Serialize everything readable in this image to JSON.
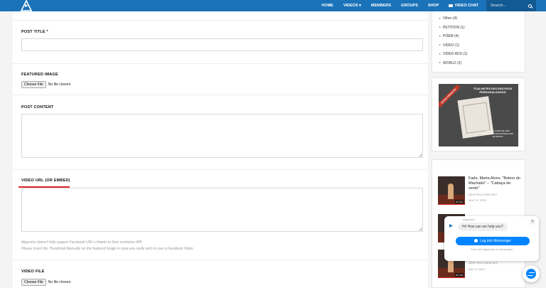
{
  "header": {
    "nav": [
      {
        "label": "HOME"
      },
      {
        "label": "VIDEOS ▾"
      },
      {
        "label": "MEMBERS"
      },
      {
        "label": "GROUPS"
      },
      {
        "label": "SHOP"
      },
      {
        "label": "VIDEO CHAT"
      }
    ],
    "search_placeholder": "Search...",
    "brand_color": "#1a72b8"
  },
  "form": {
    "post_title_label": "POST TITLE *",
    "featured_image_label": "FEATURED IMAGE",
    "choose_file": "Choose File",
    "no_file": "No file chosen",
    "post_content_label": "POST CONTENT",
    "video_url_label": "VIDEO URL (OR EMBED)",
    "note_line1": "Algarvios doesn't fully support Facebook URL's thanks to their restrictive API.",
    "note_line2": "Please insert the Thumbnail Manually on the featured image in case you really wish to use a Facebook Video.",
    "video_file_label": "VIDEO FILE",
    "choose_file_2": "Choose File",
    "no_file_2": "No file chosen"
  },
  "sidebar": {
    "categories": [
      {
        "label": "Other (4)"
      },
      {
        "label": "PETITION (1)"
      },
      {
        "label": "POEM (4)"
      },
      {
        "label": "VIDEO (1)"
      },
      {
        "label": "VIDEO ADS (1)"
      },
      {
        "label": "WORLD (2)"
      }
    ],
    "ad": {
      "title": "TOALHETES DECORATIVOS PERSONALIZADOS",
      "ribbon": "NOVOS PRODUTOS",
      "subtitle": "DESDE LOTES DE 1000 UNIDADES COM ENTREGA EM 48 HORAS"
    },
    "posts": [
      {
        "title": "Fado, Marta Alves, \"Bolero do Machado\" – \"Cabaça de vento\"",
        "author": "NEWTROJI NEM NEZ",
        "date": "MAY 10, 2020",
        "duration": "02:52"
      },
      {
        "title": "",
        "author": "",
        "date": "",
        "duration": ""
      },
      {
        "title": "",
        "author": "NEW TROJI NEM NEZ",
        "date": "MAY 8, 2020",
        "duration": "02:33"
      }
    ]
  },
  "chat": {
    "from": "Algarvios",
    "greeting": "Hi! How can we help you?",
    "login_label": "Log into Messenger",
    "subtext": "Chat with Algarvios in Messenger",
    "close": "×"
  }
}
